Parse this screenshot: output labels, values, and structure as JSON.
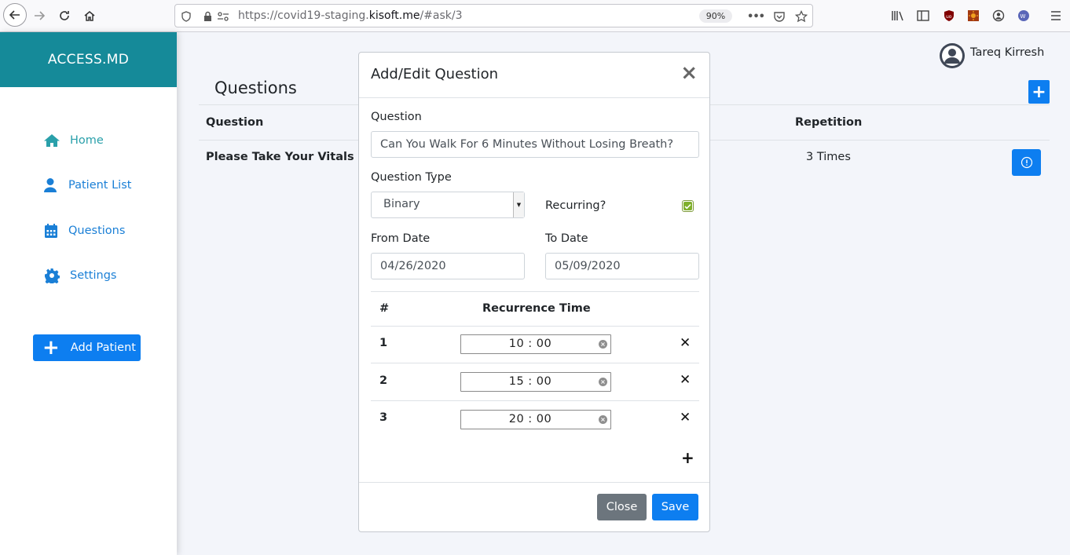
{
  "browser": {
    "url_prefix": "https://covid19-staging.",
    "url_domain": "kisoft.me",
    "url_suffix": "/#ask/3",
    "zoom": "90%",
    "more_label": "•••"
  },
  "sidebar": {
    "brand": "ACCESS.MD",
    "items": [
      {
        "label": "Home",
        "icon": "home-icon"
      },
      {
        "label": "Patient List",
        "icon": "user-icon"
      },
      {
        "label": "Questions",
        "icon": "calendar-icon"
      },
      {
        "label": "Settings",
        "icon": "gear-icon"
      }
    ],
    "add_patient_label": "Add Patient",
    "add_patient_plus": "+"
  },
  "header": {
    "user_name": "Tareq Kirresh",
    "add_plus": "+"
  },
  "page": {
    "title": "Questions",
    "columns": {
      "question": "Question",
      "repetition": "Repetition"
    },
    "rows": [
      {
        "question": "Please Take Your Vitals",
        "repetition": "3 Times"
      }
    ]
  },
  "modal": {
    "title": "Add/Edit Question",
    "close_x": "×",
    "question_label": "Question",
    "question_value": "Can You Walk For 6 Minutes Without Losing Breath?",
    "type_label": "Question Type",
    "type_value": "Binary",
    "recurring_label": "Recurring?",
    "recurring_checked": true,
    "from_label": "From Date",
    "from_value": "04/26/2020",
    "to_label": "To Date",
    "to_value": "05/09/2020",
    "table": {
      "col_num": "#",
      "col_time": "Recurrence Time",
      "rows": [
        {
          "num": "1",
          "time": "10 : 00"
        },
        {
          "num": "2",
          "time": "15 : 00"
        },
        {
          "num": "3",
          "time": "20 : 00"
        }
      ],
      "delete_glyph": "✕",
      "add_glyph": "+"
    },
    "close_button": "Close",
    "save_button": "Save"
  },
  "colors": {
    "brand": "#158a99",
    "primary": "#0d7ef0",
    "secondary": "#6c757d",
    "link": "#1a7fd6",
    "checkbox": "#7fb02c"
  }
}
